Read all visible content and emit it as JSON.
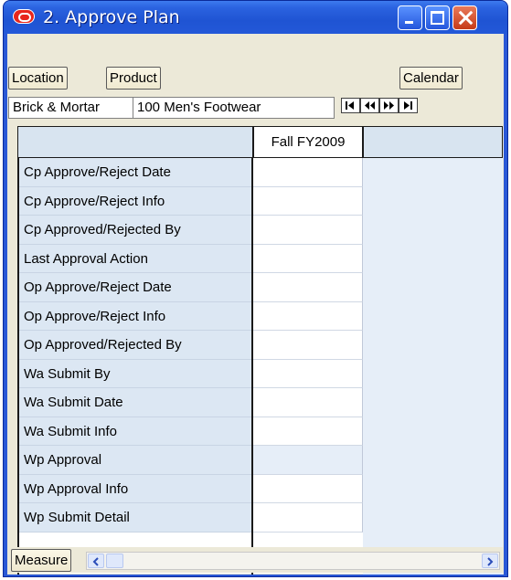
{
  "window": {
    "title": "2. Approve Plan"
  },
  "toolbar": {
    "location_label": "Location",
    "product_label": "Product",
    "calendar_label": "Calendar"
  },
  "selection": {
    "location_value": "Brick & Mortar",
    "product_value": "100 Men's Footwear"
  },
  "nav_icons": [
    "first-page-icon",
    "previous-page-icon",
    "next-page-icon",
    "last-page-icon"
  ],
  "grid": {
    "column_header": "Fall FY2009",
    "rows": [
      "Cp Approve/Reject Date",
      "Cp Approve/Reject Info",
      "Cp Approved/Rejected By",
      "Last Approval Action",
      "Op Approve/Reject Date",
      "Op Approve/Reject Info",
      "Op Approved/Rejected By",
      "Wa Submit By",
      "Wa Submit Date",
      "Wa Submit Info",
      "Wp Approval",
      "Wp Approval Info",
      "Wp Submit Detail"
    ],
    "row_value_bg": [
      "#ffffff",
      "#ffffff",
      "#ffffff",
      "#ffffff",
      "#ffffff",
      "#ffffff",
      "#ffffff",
      "#ffffff",
      "#ffffff",
      "#ffffff",
      "#e6eef8",
      "#ffffff",
      "#ffffff"
    ]
  },
  "footer": {
    "measure_label": "Measure"
  },
  "colors": {
    "titlebar": "#2358d8",
    "row_header_bg": "#dce7f3",
    "app_icon": "#e8261c"
  }
}
